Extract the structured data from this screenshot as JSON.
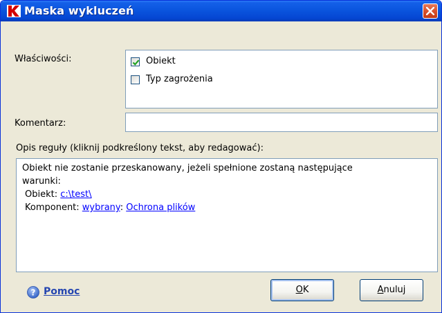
{
  "window": {
    "title": "Maska wykluczeń"
  },
  "properties": {
    "label": "Właściwości:",
    "items": [
      {
        "label": "Obiekt",
        "checked": true
      },
      {
        "label": "Typ zagrożenia",
        "checked": false
      }
    ]
  },
  "comment": {
    "label": "Komentarz:",
    "value": ""
  },
  "rule": {
    "label": "Opis reguły (kliknij podkreślony tekst, aby redagować):",
    "line1": "Obiekt nie zostanie przeskanowany, jeżeli spełnione zostaną następujące",
    "line2": "warunki:",
    "object_prefix": "Obiekt:",
    "object_link": "c:\\test\\",
    "component_prefix": "Komponent:",
    "component_link1": "wybrany",
    "component_sep": ":",
    "component_link2": "Ochrona plików"
  },
  "help": {
    "label": "Pomoc"
  },
  "buttons": {
    "ok_first": "O",
    "ok_rest": "K",
    "cancel_first": "A",
    "cancel_rest": "nuluj"
  },
  "colors": {
    "title_bar": "#0a55de",
    "dialog_bg": "#ece9d8",
    "link": "#0000ff",
    "close_button": "#d9512c"
  }
}
